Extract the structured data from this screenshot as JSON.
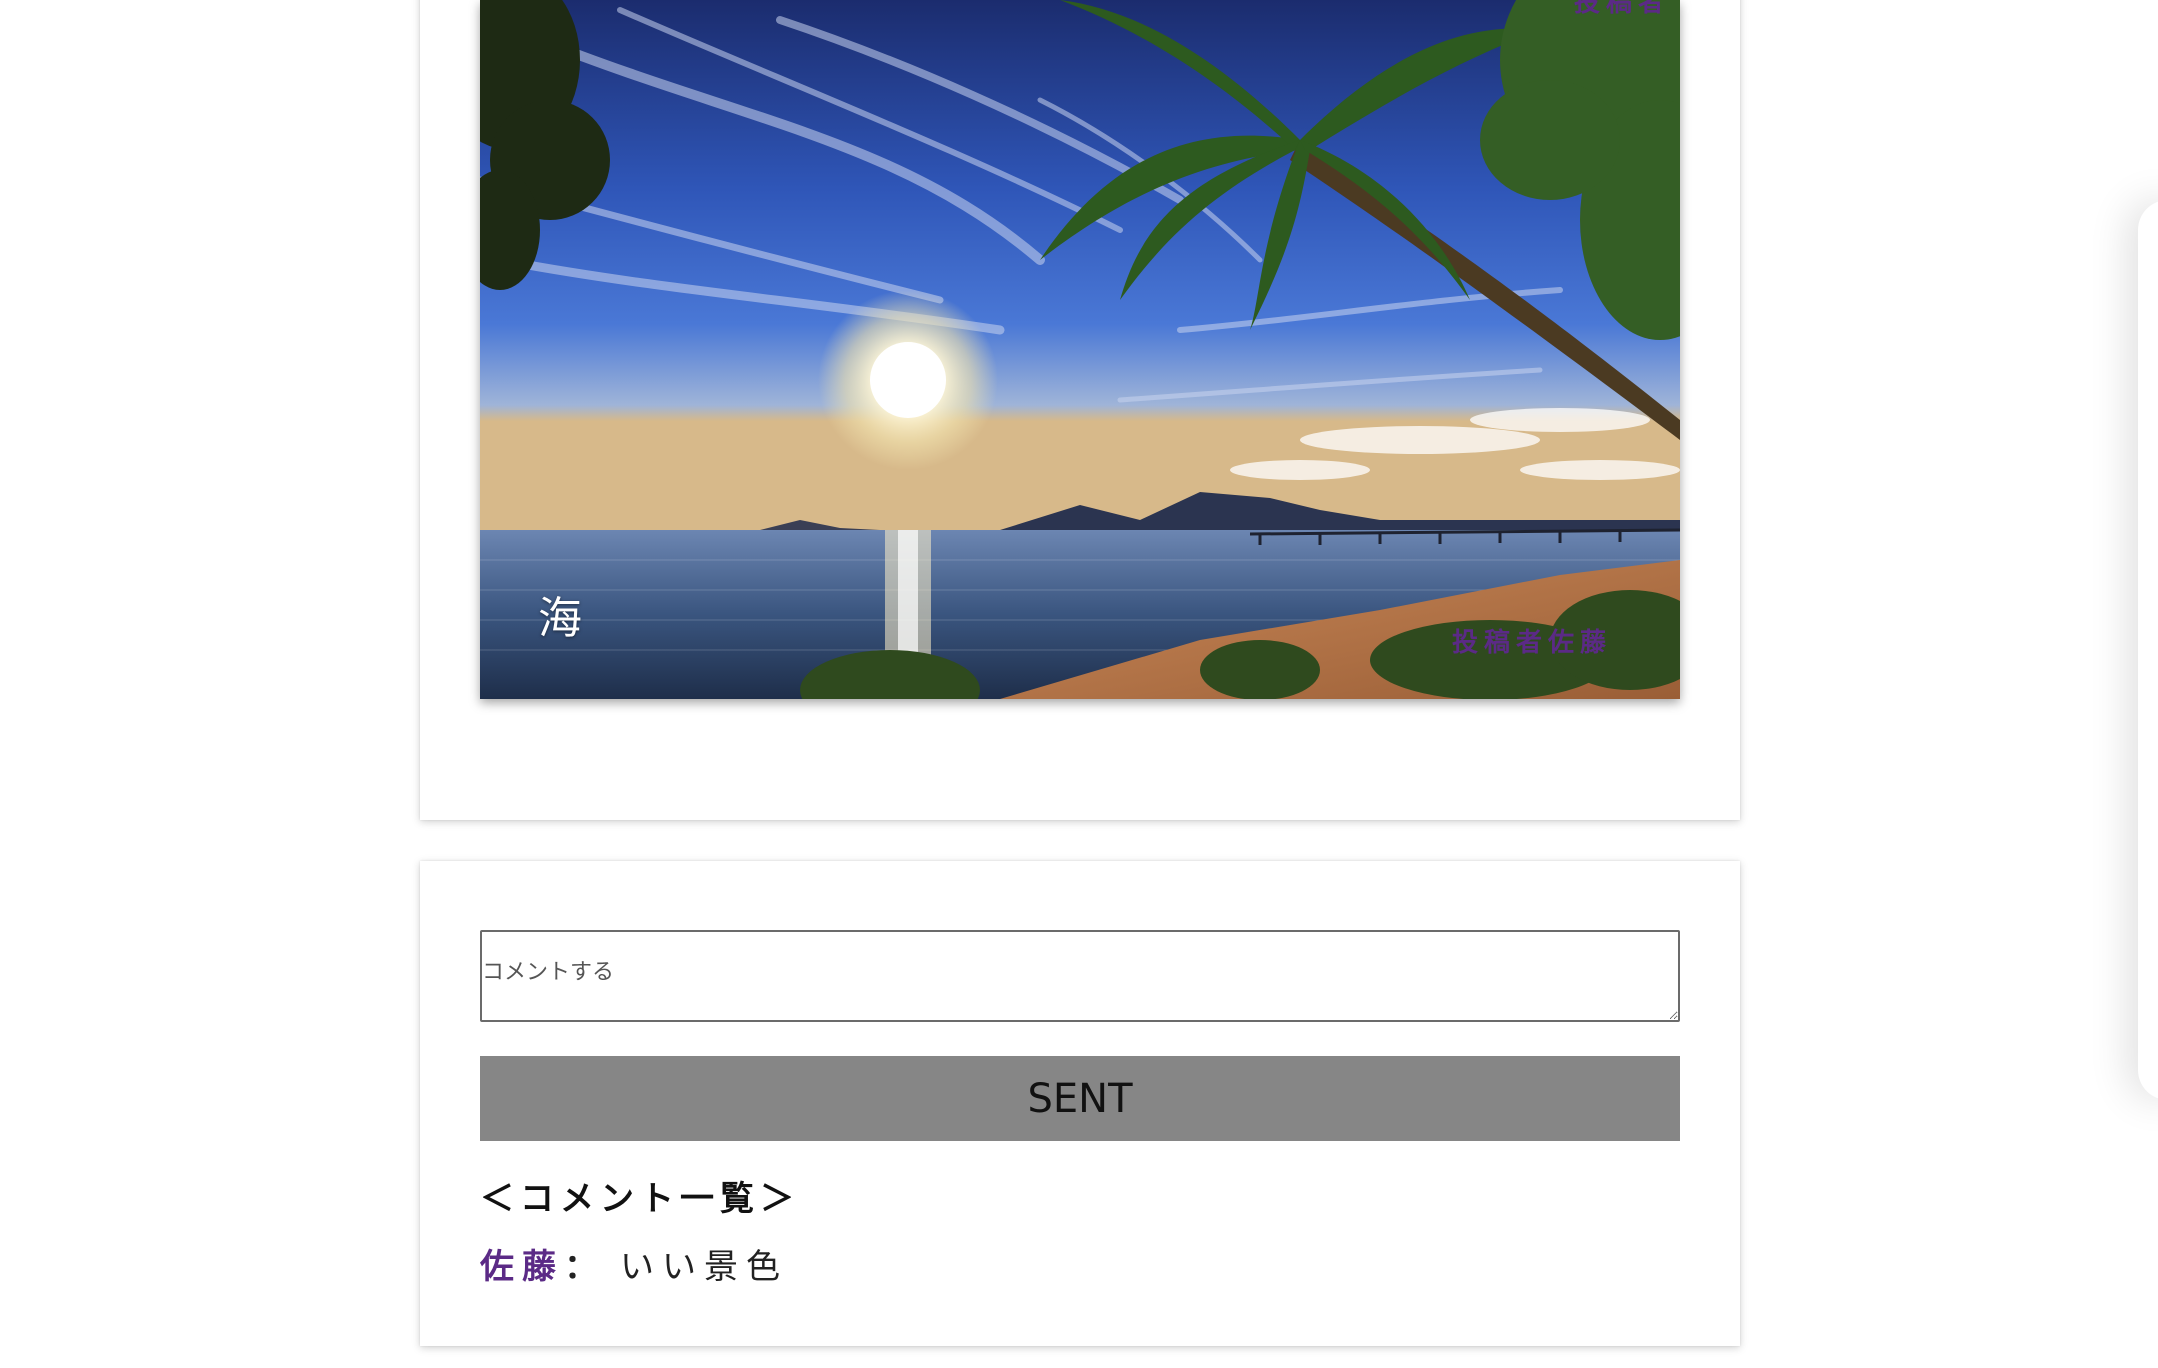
{
  "post": {
    "caption": "海",
    "owner": "投稿者佐藤",
    "owner_top": "投稿者"
  },
  "comment_form": {
    "placeholder": "コメントする",
    "submit_label": "SENT"
  },
  "comments": {
    "heading": "＜コメント一覧＞",
    "items": [
      {
        "author": "佐藤",
        "separator": "：",
        "text": "いい景色"
      }
    ]
  },
  "colors": {
    "accent": "#5b2a86",
    "button_bg": "#868686"
  }
}
